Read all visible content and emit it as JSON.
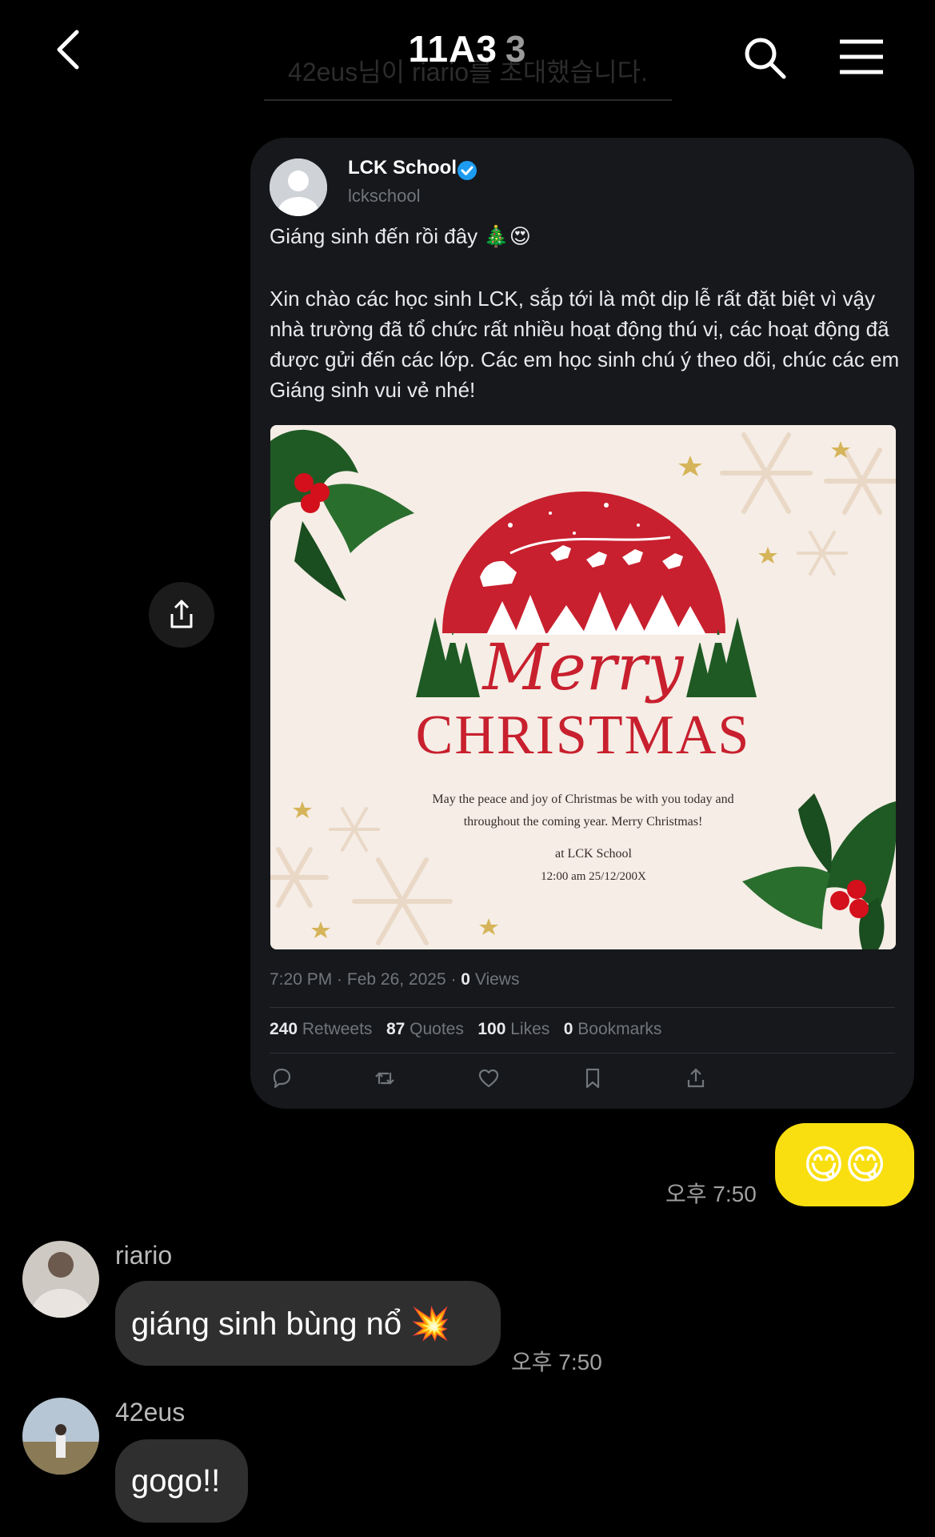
{
  "header": {
    "title": "11A3",
    "member_count": "3",
    "system_message": "42eus님이 riario를 초대했습니다."
  },
  "tweet": {
    "name": "LCK School",
    "handle": "lckschool",
    "intro": "Giáng sinh đến rồi đây 🎄😍",
    "body": "Xin chào các học sinh LCK, sắp tới là một dịp lễ rất đặt biệt vì vậy nhà trường đã tổ chức rất nhiều hoạt động thú vị, các hoạt động đã được gửi đến các lớp. Các em học sinh chú ý theo dõi, chúc các em Giáng sinh vui vẻ nhé!",
    "image": {
      "script_text": "Merry",
      "headline": "CHRISTMAS",
      "message_line1": "May the peace and joy of Christmas be with you today and",
      "message_line2": "throughout the coming year. Merry Christmas!",
      "venue": "at LCK School",
      "datetime": "12:00 am 25/12/200X"
    },
    "timestamp": "7:20 PM · Feb 26, 2025 · ",
    "views_count": "0",
    "views_label": " Views",
    "stats": {
      "retweets_count": "240",
      "retweets_label": " Retweets",
      "quotes_count": "87",
      "quotes_label": " Quotes",
      "likes_count": "100",
      "likes_label": " Likes",
      "bookmarks_count": "0",
      "bookmarks_label": " Bookmarks"
    }
  },
  "messages": [
    {
      "sender": "me",
      "text": "😋😋",
      "time": "오후 7:50"
    },
    {
      "sender": "riario",
      "text": "giáng sinh bùng nổ 💥",
      "time": "오후 7:50"
    },
    {
      "sender": "42eus",
      "text": "gogo!!"
    }
  ],
  "colors": {
    "background": "#000000",
    "my_bubble": "#f9df0f",
    "other_bubble": "#2f2f2f",
    "tweet_card": "#16181c",
    "verified": "#1d9bf0",
    "xmas_red": "#c8202e",
    "holly_green": "#1f5a24"
  },
  "icons": [
    "back-icon",
    "search-icon",
    "menu-icon",
    "share-icon",
    "verified-icon",
    "reply-icon",
    "retweet-icon",
    "like-icon",
    "bookmark-icon",
    "share-tweet-icon"
  ]
}
